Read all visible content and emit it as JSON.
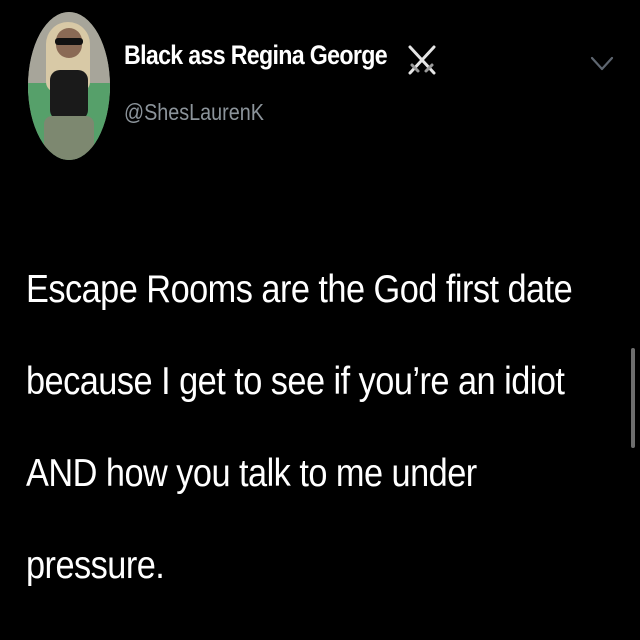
{
  "tweet": {
    "display_name": "Black ass Regina George",
    "name_emoji": "crossed-swords-icon",
    "handle": "@ShesLaurenK",
    "text_lines": [
      "Escape Rooms are the God first date",
      "because I get to see if you’re an idiot",
      "AND how you talk to me under",
      "pressure."
    ]
  },
  "colors": {
    "background": "#000000",
    "text": "#ffffff",
    "handle": "#8c949b"
  },
  "icons": {
    "more_menu": "chevron-down-icon"
  }
}
